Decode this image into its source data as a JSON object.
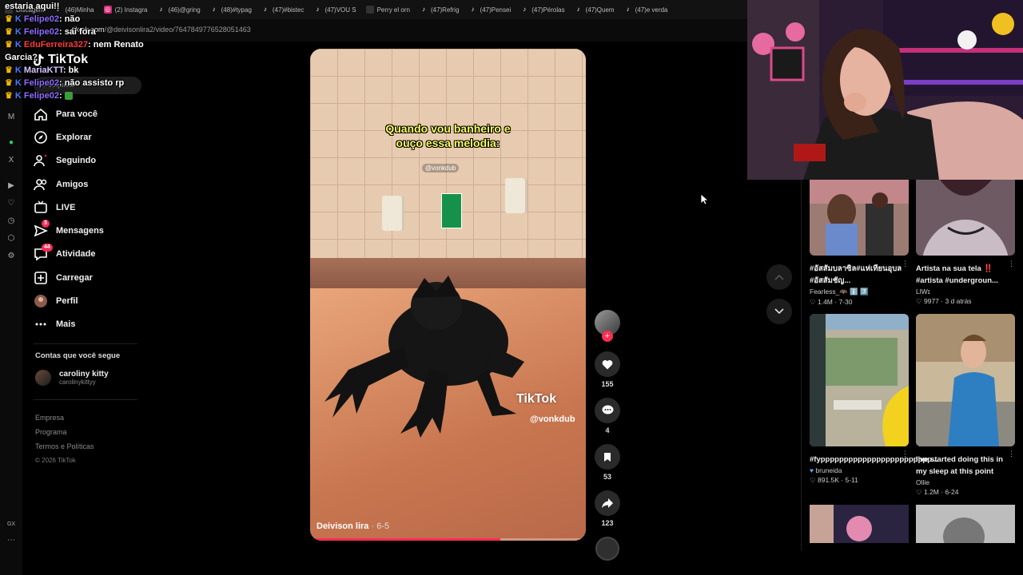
{
  "browser": {
    "tabs": [
      {
        "label": "Discagem",
        "icon": "discord-icon"
      },
      {
        "label": "(46)Minha",
        "icon": "tiktok-icon"
      },
      {
        "label": "(2) Instagra",
        "icon": "instagram-icon"
      },
      {
        "label": "(46)@gring",
        "icon": "tiktok-icon"
      },
      {
        "label": "(48)#typag",
        "icon": "tiktok-icon"
      },
      {
        "label": "(47)#bistec",
        "icon": "tiktok-icon"
      },
      {
        "label": "(47)VOU S",
        "icon": "tiktok-icon"
      },
      {
        "label": "Perry el orn",
        "icon": "page-icon"
      },
      {
        "label": "(47)Refrig",
        "icon": "tiktok-icon"
      },
      {
        "label": "(47)Pensei",
        "icon": "tiktok-icon"
      },
      {
        "label": "(47)Pérolas",
        "icon": "tiktok-icon"
      },
      {
        "label": "(47)Quem",
        "icon": "tiktok-icon"
      },
      {
        "label": "(47)e verda",
        "icon": "tiktok-icon"
      }
    ],
    "url_prefix": "tiktok.com",
    "url_path": "/@deivisonlira2/video/7647849776528051463"
  },
  "chat": [
    {
      "user": "",
      "text": "estaria aqui!!"
    },
    {
      "user": "Felipe02",
      "text": "não"
    },
    {
      "user": "Felipe02",
      "text": "sai fora"
    },
    {
      "user": "EduFerreira327",
      "text": "nem Renato"
    },
    {
      "user": "",
      "text": "Garcia?"
    },
    {
      "user": "MariaKTT",
      "text": "bk"
    },
    {
      "user": "Felipe02",
      "text": "não assisto rp"
    },
    {
      "user": "Felipe02",
      "text": ""
    }
  ],
  "tiktok": {
    "logo": "TikTok",
    "search_placeholder": "Pesquisar",
    "nav": [
      {
        "label": "Para você",
        "icon": "home-icon",
        "badge": ""
      },
      {
        "label": "Explorar",
        "icon": "compass-icon",
        "badge": ""
      },
      {
        "label": "Seguindo",
        "icon": "following-icon",
        "badge": ""
      },
      {
        "label": "Amigos",
        "icon": "friends-icon",
        "badge": ""
      },
      {
        "label": "LIVE",
        "icon": "live-icon",
        "badge": ""
      },
      {
        "label": "Mensagens",
        "icon": "messages-icon",
        "badge": "3"
      },
      {
        "label": "Atividade",
        "icon": "activity-icon",
        "badge": "44"
      },
      {
        "label": "Carregar",
        "icon": "upload-icon",
        "badge": ""
      },
      {
        "label": "Perfil",
        "icon": "profile-avatar",
        "badge": ""
      },
      {
        "label": "Mais",
        "icon": "more-icon",
        "badge": ""
      }
    ],
    "following_title": "Contas que você segue",
    "following": [
      {
        "name": "caroliny kitty",
        "handle": "carolinykittyy"
      }
    ],
    "footer": [
      "Empresa",
      "Programa",
      "Termos e Políticas"
    ],
    "copyright": "© 2026 TikTok"
  },
  "video": {
    "caption_line1": "Quando vou banheiro e",
    "caption_line2": "ouço essa melodia:",
    "credit": "@vonkdub",
    "watermark": "TikTok",
    "watermark_handle": "@vonkdub",
    "author": "Deivison lira",
    "date": " · 6-5",
    "progress": 0.69
  },
  "actions": {
    "likes": "155",
    "comments": "4",
    "saves": "53",
    "shares": "123"
  },
  "grid": [
    {
      "title": "#อัสสัมบลาซิล#แห่เทียนอุบล #อัสสัมชัญ...",
      "author": "Fearless_🦇 ℹ️ 7️⃣",
      "likes": "1.4M",
      "date": "7-30",
      "verified": false
    },
    {
      "title": "Artista na sua tela ‼️ #artista #undergroun...",
      "author": "LlWɪ",
      "likes": "9977",
      "date": "3 d atrás",
      "verified": false
    },
    {
      "title": "#fypppppppppppppppppppppppp...",
      "author": "bruneida",
      "likes": "891.5K",
      "date": "5-11",
      "verified": true
    },
    {
      "title": "I've started doing this in my sleep at this point",
      "author": "Ollie",
      "likes": "1.2M",
      "date": "6-24",
      "verified": false
    }
  ],
  "colors": {
    "accent": "#fe2c55",
    "caption": "#f8ff5a",
    "background": "#000000"
  }
}
